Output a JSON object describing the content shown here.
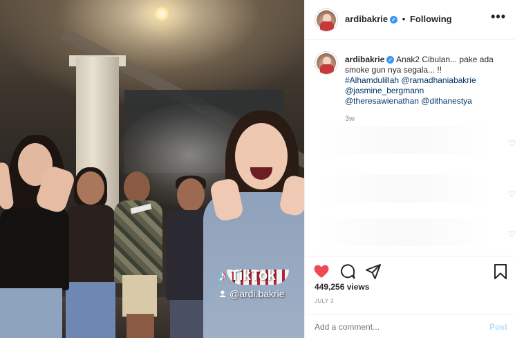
{
  "media": {
    "watermark_brand": "TikTok",
    "watermark_handle": "@ardi.bakrie",
    "icons": [
      "tiktok-note-icon",
      "user-icon"
    ]
  },
  "header": {
    "username": "ardibakrie",
    "separator": "•",
    "follow_status": "Following",
    "more": "•••"
  },
  "caption": {
    "username": "ardibakrie",
    "text": "Anak2 Cibulan... pake ada smoke gun nya segala... !!",
    "hashtag": "#Alhamdulillah",
    "mentions": [
      "@ramadhaniabakrie",
      "@jasmine_bergmann",
      "@theresawienathan",
      "@dithanestya"
    ],
    "time": "3w"
  },
  "actions": {
    "icons": [
      "heart-filled-icon",
      "comment-icon",
      "share-icon",
      "bookmark-icon"
    ],
    "like_color": "#ed4956"
  },
  "stats": {
    "views": "449,256 views",
    "date": "JULY 3"
  },
  "comment": {
    "placeholder": "Add a comment...",
    "post_label": "Post"
  }
}
